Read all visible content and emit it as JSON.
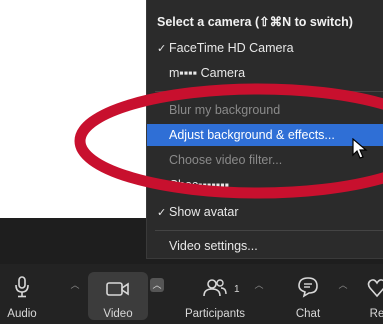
{
  "camera_menu": {
    "header": "Select a camera (⇧⌘N to switch)",
    "items": [
      {
        "label": "FaceTime HD Camera",
        "checked": true,
        "state": "normal"
      },
      {
        "label": "m▪▪▪▪ Camera",
        "checked": false,
        "state": "normal"
      },
      {
        "label": "Blur my background",
        "checked": false,
        "state": "disabled"
      },
      {
        "label": "Adjust background & effects...",
        "checked": false,
        "state": "highlighted"
      },
      {
        "label": "Choose video filter...",
        "checked": false,
        "state": "disabled"
      },
      {
        "label": "Chec▪▪▪▪▪▪▪",
        "checked": false,
        "state": "normal"
      },
      {
        "label": "Show avatar",
        "checked": true,
        "state": "normal"
      },
      {
        "label": "Video settings...",
        "checked": false,
        "state": "normal"
      }
    ]
  },
  "toolbar": {
    "audio_label": "Audio",
    "video_label": "Video",
    "participants_label": "Participants",
    "participants_count": "1",
    "chat_label": "Chat",
    "reactions_label": "Re"
  },
  "colors": {
    "highlight": "#2f6fd6",
    "annotation": "#c8102e",
    "menu_bg": "#2b2b2b",
    "toolbar_bg": "#232323"
  }
}
